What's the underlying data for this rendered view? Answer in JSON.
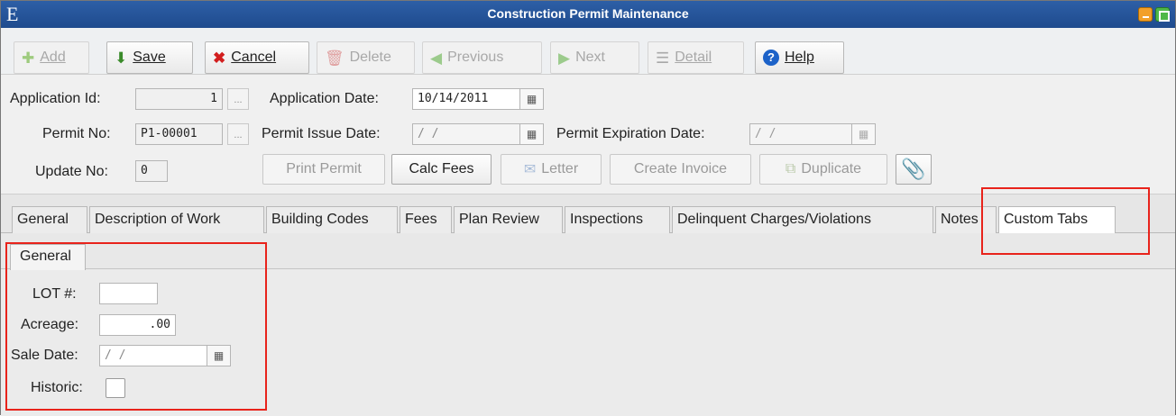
{
  "window": {
    "app_glyph": "E",
    "title": "Construction Permit Maintenance"
  },
  "toolbar": {
    "add": "Add",
    "save": "Save",
    "cancel": "Cancel",
    "delete": "Delete",
    "previous": "Previous",
    "next": "Next",
    "detail": "Detail",
    "help": "Help"
  },
  "form": {
    "application_id_label": "Application Id:",
    "application_id": "1",
    "application_date_label": "Application Date:",
    "application_date": "10/14/2011",
    "permit_no_label": "Permit No:",
    "permit_no": "P1-00001",
    "permit_issue_date_label": "Permit Issue Date:",
    "permit_issue_date": "/ /",
    "permit_expiration_date_label": "Permit Expiration Date:",
    "permit_expiration_date": "/ /",
    "update_no_label": "Update No:",
    "update_no": "0",
    "ellipsis": "..."
  },
  "actions": {
    "print_permit": "Print Permit",
    "calc_fees": "Calc Fees",
    "letter": "Letter",
    "create_invoice": "Create Invoice",
    "duplicate": "Duplicate"
  },
  "tabs": [
    "General",
    "Description of Work",
    "Building Codes",
    "Fees",
    "Plan Review",
    "Inspections",
    "Delinquent Charges/Violations",
    "Notes",
    "Custom Tabs"
  ],
  "custom_tab": {
    "subtab": "General",
    "lot_label": "LOT #:",
    "lot_value": "",
    "acreage_label": "Acreage:",
    "acreage_value": ".00",
    "sale_date_label": "Sale Date:",
    "sale_date_value": "/ /",
    "historic_label": "Historic:",
    "historic_checked": false
  },
  "colors": {
    "highlight": "#e8231b",
    "titlebar": "#1f4b8e"
  },
  "icons": [
    "add-icon",
    "save-icon",
    "cancel-icon",
    "delete-icon",
    "previous-icon",
    "next-icon",
    "detail-icon",
    "help-icon",
    "calendar-icon",
    "envelope-icon",
    "duplicate-icon",
    "paperclip-icon"
  ]
}
